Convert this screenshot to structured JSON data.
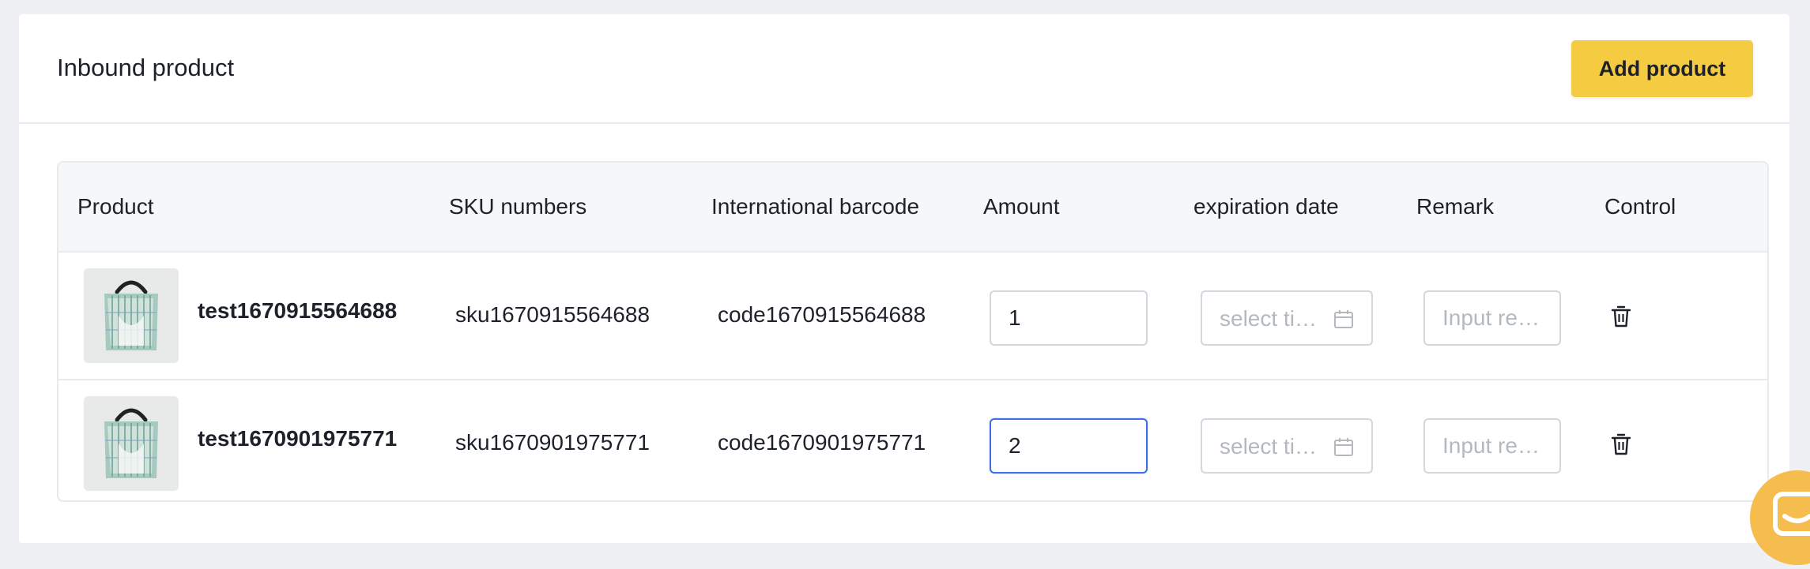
{
  "header": {
    "title": "Inbound product",
    "add_button_label": "Add product"
  },
  "table": {
    "columns": {
      "product": "Product",
      "sku": "SKU numbers",
      "barcode": "International barcode",
      "amount": "Amount",
      "expiration": "expiration date",
      "remark": "Remark",
      "control": "Control"
    },
    "rows": [
      {
        "name": "test1670915564688",
        "sku": "sku1670915564688",
        "barcode": "code1670915564688",
        "amount": "1",
        "date_placeholder": "select time",
        "remark_placeholder": "Input remark"
      },
      {
        "name": "test1670901975771",
        "sku": "sku1670901975771",
        "barcode": "code1670901975771",
        "amount": "2",
        "date_placeholder": "select time",
        "remark_placeholder": "Input remark"
      }
    ]
  },
  "icons": {
    "date": "calendar-icon",
    "delete": "trash-icon",
    "chat": "chat-icon"
  },
  "colors": {
    "accent": "#f5cb42",
    "focus": "#3f6fe8",
    "chat": "#f5bc4e"
  }
}
